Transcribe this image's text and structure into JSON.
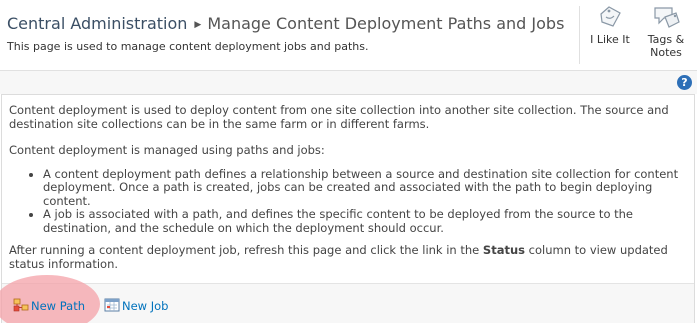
{
  "breadcrumb": {
    "root": "Central Administration",
    "separator": "▶",
    "current": "Manage Content Deployment Paths and Jobs"
  },
  "page_description": "This page is used to manage content deployment jobs and paths.",
  "social": {
    "like_label": "I Like It",
    "tags_label_line1": "Tags &",
    "tags_label_line2": "Notes"
  },
  "help": {
    "glyph": "?"
  },
  "content": {
    "intro": "Content deployment is used to deploy content from one site collection into another site collection. The source and destination site collections can be in the same farm or in different farms.",
    "managed": "Content deployment is managed using paths and jobs:",
    "bullets": [
      "A content deployment path defines a relationship between a source and destination site collection for content deployment. Once a path is created, jobs can be created and associated with the path to begin deploying content.",
      "A job is associated with a path, and defines the specific content to be deployed from the source to the destination, and the schedule on which the deployment should occur."
    ],
    "after_before": "After running a content deployment job, refresh this page and click the link in the",
    "after_bold": "Status",
    "after_after": "column to view updated status information."
  },
  "toolbar": {
    "new_path": "New Path",
    "new_job": "New Job"
  },
  "colors": {
    "link": "#0072bc",
    "highlight": "#f4a2a8",
    "help_icon": "#2d6fb7"
  }
}
